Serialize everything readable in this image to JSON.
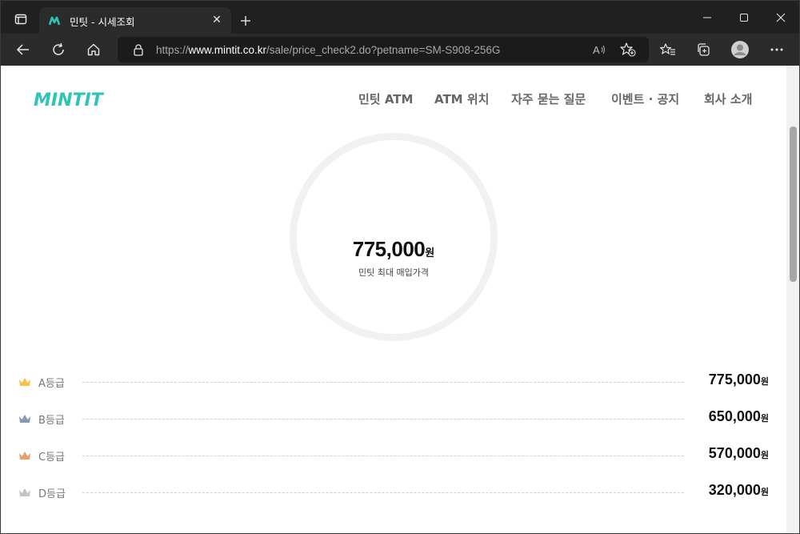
{
  "browser": {
    "tab": {
      "title": "민팃 - 시세조회"
    },
    "url": {
      "prefix": "https://",
      "host": "www.mintit.co.kr",
      "path": "/sale/price_check2.do?petname=SM-S908-256G"
    }
  },
  "site": {
    "logo_text": "MINTIT",
    "brand_color": "#2ec4b6",
    "nav": [
      "민팃 ATM",
      "ATM 위치",
      "자주 묻는 질문",
      "이벤트 · 공지",
      "회사 소개"
    ]
  },
  "summary": {
    "price": "775,000",
    "currency": "원",
    "caption": "민팃 최대 매입가격"
  },
  "grades": [
    {
      "label": "A등급",
      "price": "775,000",
      "currency": "원",
      "crown_color": "#f2c24a"
    },
    {
      "label": "B등급",
      "price": "650,000",
      "currency": "원",
      "crown_color": "#8b95b5"
    },
    {
      "label": "C등급",
      "price": "570,000",
      "currency": "원",
      "crown_color": "#e0a070"
    },
    {
      "label": "D등급",
      "price": "320,000",
      "currency": "원",
      "crown_color": "#c4c4c4"
    }
  ]
}
